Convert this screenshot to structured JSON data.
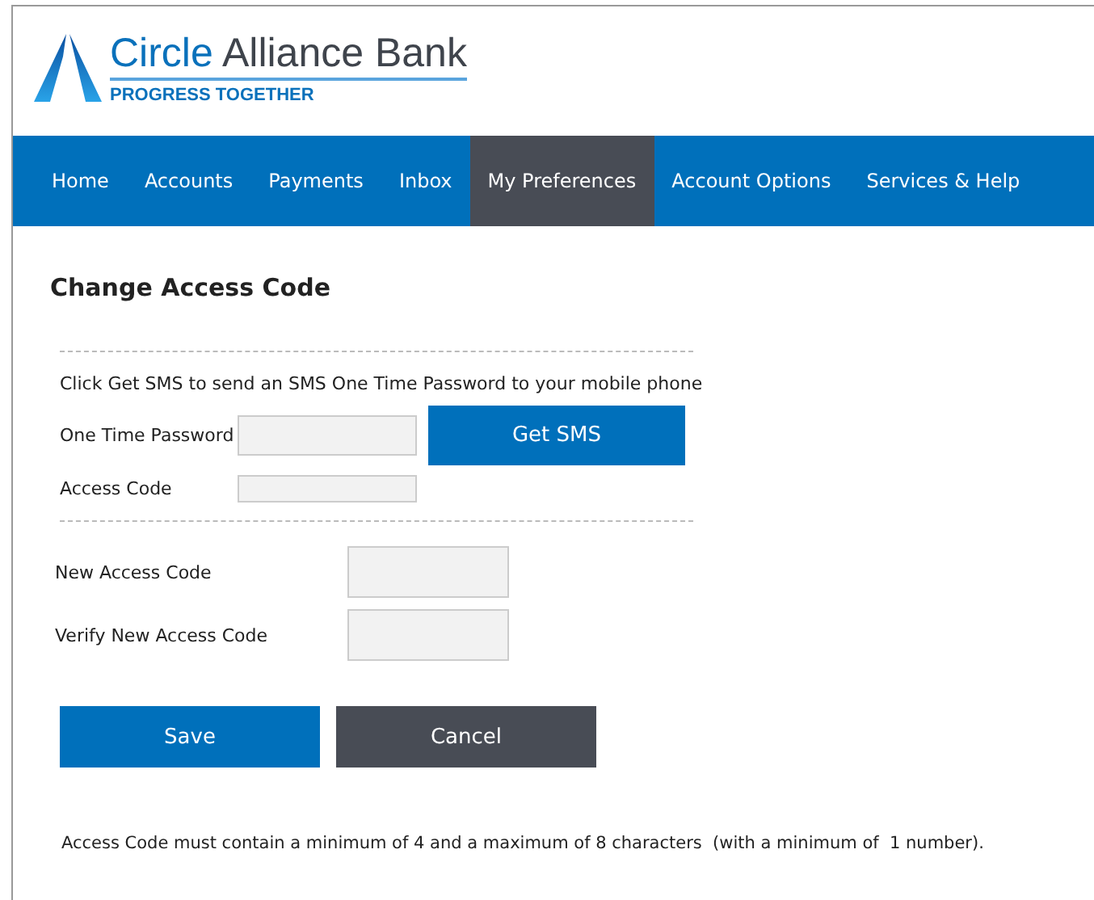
{
  "logo": {
    "name_part_1": "Circle",
    "name_part_2": "Alliance Bank",
    "tagline": "PROGRESS TOGETHER"
  },
  "nav": [
    {
      "label": "Home",
      "selected": false
    },
    {
      "label": "Accounts",
      "selected": false
    },
    {
      "label": "Payments",
      "selected": false
    },
    {
      "label": "Inbox",
      "selected": false
    },
    {
      "label": "My Preferences",
      "selected": true
    },
    {
      "label": "Account Options",
      "selected": false
    },
    {
      "label": "Services & Help",
      "selected": false
    }
  ],
  "page_title": "Change Access Code",
  "instruction": "Click Get SMS to send an SMS One Time Password to your mobile phone",
  "otp_label": "One Time Password",
  "get_sms_button": "Get SMS",
  "access_code_label": "Access Code",
  "new_code_label": "New Access Code",
  "verify_code_label": "Verify New Access Code",
  "buttons": [
    {
      "label": "Save",
      "kind": "primary"
    },
    {
      "label": "Cancel",
      "kind": "secondary"
    }
  ],
  "note": "Access Code must contain a minimum of 4 and a maximum of 8 characters  (with a minimum of  1 number)."
}
